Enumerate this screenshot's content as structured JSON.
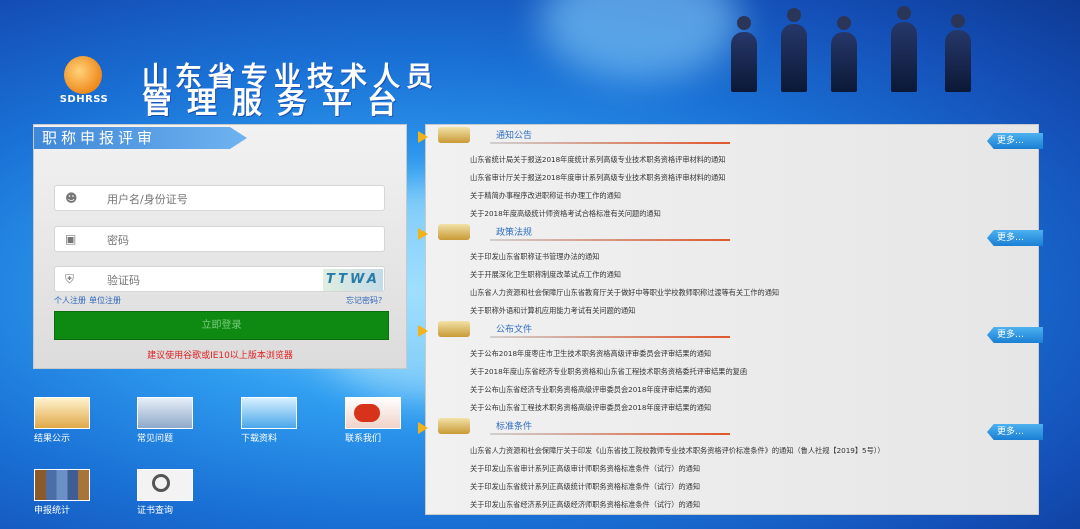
{
  "header": {
    "logo_text": "SDHRSS",
    "title_line1": "山东省专业技术人员",
    "title_line2": "管理服务平台"
  },
  "login": {
    "heading": "职称申报评审",
    "username_placeholder": "用户名/身份证号",
    "password_placeholder": "密码",
    "captcha_placeholder": "验证码",
    "captcha_image_text": "TTWA",
    "personal_register": "个人注册",
    "unit_register": "单位注册",
    "forgot_password": "忘记密码？",
    "login_button": "立即登录",
    "browser_tip": "建议使用谷歌或IE10以上版本浏览器"
  },
  "quick_links": [
    {
      "label": "结果公示",
      "icon": "scales-icon",
      "color": "#f0c670"
    },
    {
      "label": "常见问题",
      "icon": "question-icon",
      "color": "#9fb8d6"
    },
    {
      "label": "下载资料",
      "icon": "download-icon",
      "color": "#7fc3f3"
    },
    {
      "label": "联系我们",
      "icon": "phone-icon",
      "color": "#e04a2a"
    },
    {
      "label": "申报统计",
      "icon": "binders-icon",
      "color": "#6d8ac0"
    },
    {
      "label": "证书查询",
      "icon": "magnifier-icon",
      "color": "#d9d9d9"
    }
  ],
  "news": {
    "more_label": "更多…",
    "sections": [
      {
        "title": "通知公告",
        "items": [
          "山东省统计局关于报送2018年度统计系列高级专业技术职务资格评审材料的通知",
          "山东省审计厅关于报送2018年度审计系列高级专业技术职务资格评审材料的通知",
          "关于精简办事程序改进职称证书办理工作的通知",
          "关于2018年度高级统计师资格考试合格标准有关问题的通知"
        ]
      },
      {
        "title": "政策法规",
        "items": [
          "关于印发山东省职称证书管理办法的通知",
          "关于开展深化卫生职称制度改革试点工作的通知",
          "山东省人力资源和社会保障厅山东省教育厅关于做好中等职业学校教师职称过渡等有关工作的通知",
          "关于职称外语和计算机应用能力考试有关问题的通知"
        ]
      },
      {
        "title": "公布文件",
        "items": [
          "关于公布2018年度枣庄市卫生技术职务资格高级评审委员会评审结果的通知",
          "关于2018年度山东省经济专业职务资格和山东省工程技术职务资格委托评审结果的复函",
          "关于公布山东省经济专业职务资格高级评审委员会2018年度评审结果的通知",
          "关于公布山东省工程技术职务资格高级评审委员会2018年度评审结果的通知"
        ]
      },
      {
        "title": "标准条件",
        "items": [
          "山东省人力资源和社会保障厅关于印发《山东省技工院校教师专业技术职务资格评价标准条件》的通知（鲁人社规【2019】5号））",
          "关于印发山东省审计系列正高级审计师职务资格标准条件（试行）的通知",
          "关于印发山东省统计系列正高级统计师职务资格标准条件（试行）的通知",
          "关于印发山东省经济系列正高级经济师职务资格标准条件（试行）的通知"
        ]
      }
    ]
  }
}
